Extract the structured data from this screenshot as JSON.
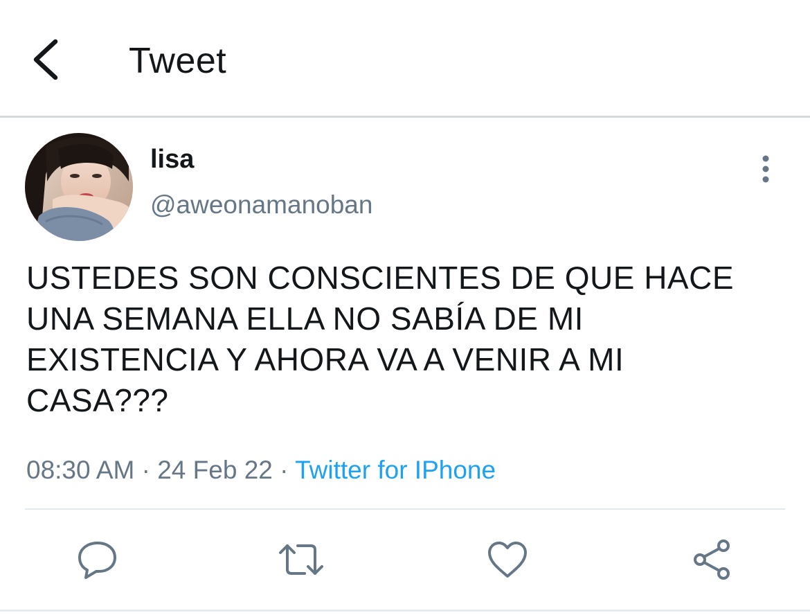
{
  "header": {
    "title": "Tweet",
    "back_icon": "chevron-left-icon"
  },
  "tweet": {
    "author": {
      "display_name": "lisa",
      "handle": "@aweonamanoban",
      "avatar_icon": "profile-photo"
    },
    "more_icon": "vertical-dots-icon",
    "text": "USTEDES SON CONSCIENTES DE QUE HACE\nUNA SEMANA ELLA NO SABÍA DE MI\nEXISTENCIA Y AHORA VA A VENIR A MI\nCASA???",
    "time": "08:30 AM",
    "separator": "·",
    "date": "24 Feb 22",
    "source": "Twitter for IPhone"
  },
  "actions": [
    {
      "icon": "reply-icon"
    },
    {
      "icon": "retweet-icon"
    },
    {
      "icon": "like-icon"
    },
    {
      "icon": "share-icon"
    }
  ],
  "colors": {
    "text": "#14171a",
    "secondary": "#657786",
    "link": "#1da1f2",
    "icon": "#657786",
    "divider": "#e1e8ed"
  }
}
